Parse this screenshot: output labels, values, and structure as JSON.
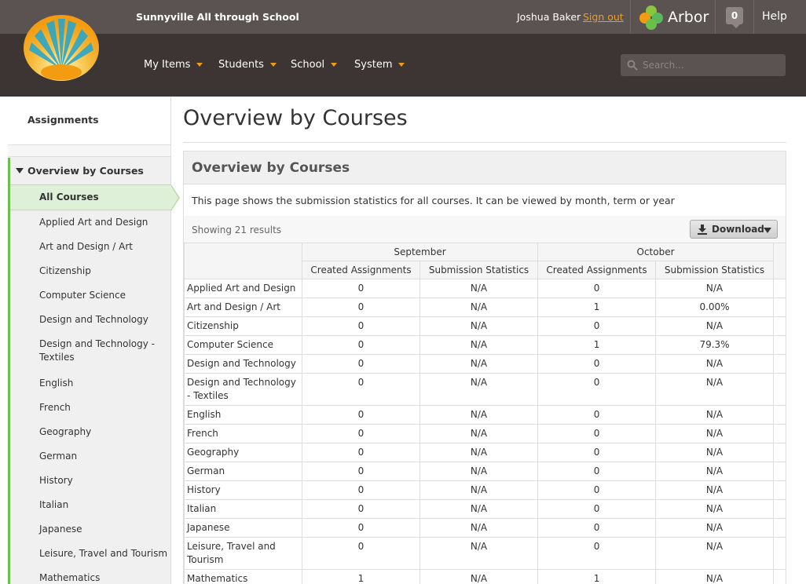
{
  "header": {
    "school_name": "Sunnyville All through School",
    "user_name": "Joshua Baker",
    "sign_out": "Sign out",
    "brand": "Arbor",
    "notifications": "0",
    "help": "Help",
    "menu": [
      {
        "label": "My Items"
      },
      {
        "label": "Students"
      },
      {
        "label": "School"
      },
      {
        "label": "System"
      }
    ],
    "search_placeholder": "Search..."
  },
  "sidebar": {
    "heading": "Assignments",
    "section": "Overview by Courses",
    "active": "All Courses",
    "items": [
      "Applied Art and Design",
      "Art and Design / Art",
      "Citizenship",
      "Computer Science",
      "Design and Technology",
      "Design and Technology - Textiles",
      "English",
      "French",
      "Geography",
      "German",
      "History",
      "Italian",
      "Japanese",
      "Leisure, Travel and Tourism",
      "Mathematics"
    ]
  },
  "main": {
    "title": "Overview by Courses",
    "panel_title": "Overview by Courses",
    "description": "This page shows the submission statistics for all courses. It can be viewed by month, term or year",
    "results": "Showing 21 results",
    "download": "Download",
    "months": [
      "September",
      "October"
    ],
    "columns": [
      "Created Assignments",
      "Submission Statistics",
      "Created Assignments",
      "Submission Statistics"
    ],
    "rows": [
      {
        "course": "Applied Art and Design",
        "sep_created": "0",
        "sep_stats": "N/A",
        "oct_created": "0",
        "oct_stats": "N/A"
      },
      {
        "course": "Art and Design / Art",
        "sep_created": "0",
        "sep_stats": "N/A",
        "oct_created": "1",
        "oct_stats": "0.00%"
      },
      {
        "course": "Citizenship",
        "sep_created": "0",
        "sep_stats": "N/A",
        "oct_created": "0",
        "oct_stats": "N/A"
      },
      {
        "course": "Computer Science",
        "sep_created": "0",
        "sep_stats": "N/A",
        "oct_created": "1",
        "oct_stats": "79.3%"
      },
      {
        "course": "Design and Technology",
        "sep_created": "0",
        "sep_stats": "N/A",
        "oct_created": "0",
        "oct_stats": "N/A"
      },
      {
        "course": "Design and Technology - Textiles",
        "sep_created": "0",
        "sep_stats": "N/A",
        "oct_created": "0",
        "oct_stats": "N/A"
      },
      {
        "course": "English",
        "sep_created": "0",
        "sep_stats": "N/A",
        "oct_created": "0",
        "oct_stats": "N/A"
      },
      {
        "course": "French",
        "sep_created": "0",
        "sep_stats": "N/A",
        "oct_created": "0",
        "oct_stats": "N/A"
      },
      {
        "course": "Geography",
        "sep_created": "0",
        "sep_stats": "N/A",
        "oct_created": "0",
        "oct_stats": "N/A"
      },
      {
        "course": "German",
        "sep_created": "0",
        "sep_stats": "N/A",
        "oct_created": "0",
        "oct_stats": "N/A"
      },
      {
        "course": "History",
        "sep_created": "0",
        "sep_stats": "N/A",
        "oct_created": "0",
        "oct_stats": "N/A"
      },
      {
        "course": "Italian",
        "sep_created": "0",
        "sep_stats": "N/A",
        "oct_created": "0",
        "oct_stats": "N/A"
      },
      {
        "course": "Japanese",
        "sep_created": "0",
        "sep_stats": "N/A",
        "oct_created": "0",
        "oct_stats": "N/A"
      },
      {
        "course": "Leisure, Travel and Tourism",
        "sep_created": "0",
        "sep_stats": "N/A",
        "oct_created": "0",
        "oct_stats": "N/A"
      },
      {
        "course": "Mathematics",
        "sep_created": "1",
        "sep_stats": "N/A",
        "oct_created": "1",
        "oct_stats": "N/A"
      }
    ]
  },
  "colors": {
    "topbar": "#5a5352",
    "navbar": "#3c3534",
    "accent": "#f39c12",
    "active_green": "#dff0d8",
    "green_bar": "#6cc04a"
  },
  "icons": [
    "sun-logo-icon",
    "arbor-leaf-icon",
    "search-icon",
    "download-icon",
    "caret-down-icon"
  ]
}
